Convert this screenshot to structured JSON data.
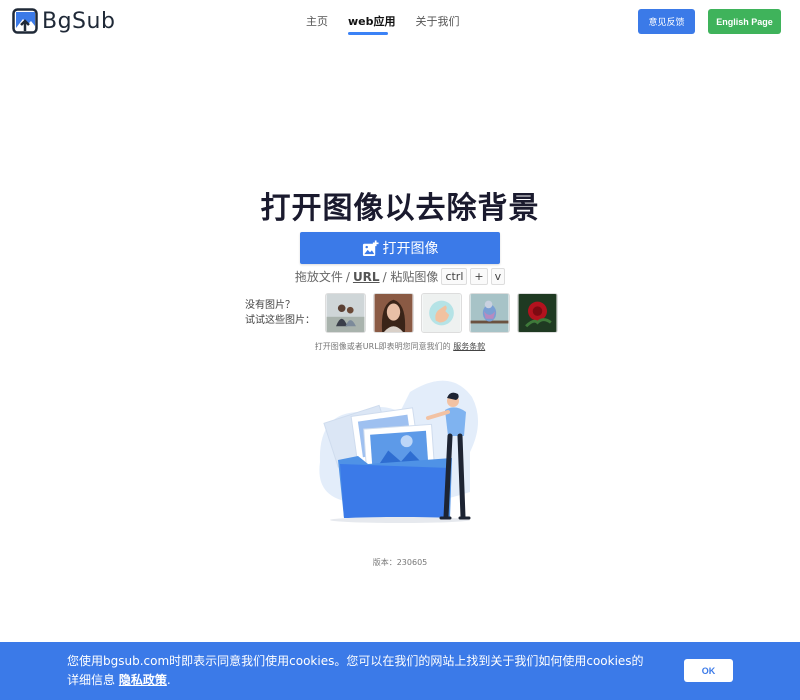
{
  "header": {
    "logo_text": "BgSub",
    "nav": [
      {
        "label": "主页"
      },
      {
        "label": "web应用"
      },
      {
        "label": "关于我们"
      }
    ],
    "feedback_label": "意见反馈",
    "english_label": "English Page"
  },
  "main": {
    "title": "打开图像以去除背景",
    "open_button_label": "打开图像",
    "hint": {
      "drag": "拖放文件",
      "sep1": "/",
      "url": "URL",
      "sep2": "/ 粘贴图像",
      "key_ctrl": "ctrl",
      "plus": "+",
      "key_v": "v"
    },
    "samples_label_line1": "没有图片？",
    "samples_label_line2": "试试这些图片：",
    "terms_prefix": "打开图像或者URL即表明您同意我们的",
    "terms_link": "服务条款",
    "version": "版本：230605"
  },
  "cookie": {
    "text": "您使用bgsub.com时即表示同意我们使用cookies。您可以在我们的网站上找到关于我们如何使用cookies的详细信息",
    "link": "隐私政策",
    "suffix": ".",
    "ok_label": "OK"
  },
  "colors": {
    "primary": "#3b7ae8",
    "green": "#3fb35b"
  }
}
